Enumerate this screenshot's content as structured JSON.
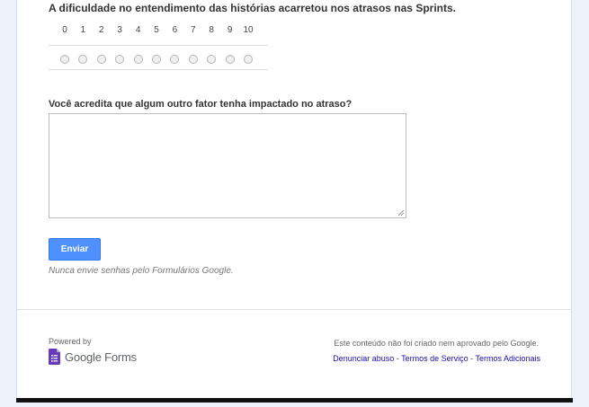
{
  "question_scale": {
    "title": "A dificuldade no entendimento das histórias acarretou nos atrasos nas Sprints.",
    "options": [
      "0",
      "1",
      "2",
      "3",
      "4",
      "5",
      "6",
      "7",
      "8",
      "9",
      "10"
    ]
  },
  "question_text": {
    "title": "Você acredita que algum outro fator tenha impactado no atraso?",
    "value": ""
  },
  "submit": {
    "label": "Enviar",
    "color": "#4d90fe"
  },
  "password_warning": "Nunca envie senhas pelo Formulários Google.",
  "footer": {
    "powered_by": "Powered by",
    "brand": "Google Forms",
    "brand_icon": "google-forms-icon",
    "brand_color": "#673ab7",
    "disclaimer": "Este conteúdo não foi criado nem aprovado pelo Google.",
    "links": [
      "Denunciar abuso",
      "Termos de Serviço",
      "Termos Adicionais"
    ],
    "separator": " - "
  }
}
